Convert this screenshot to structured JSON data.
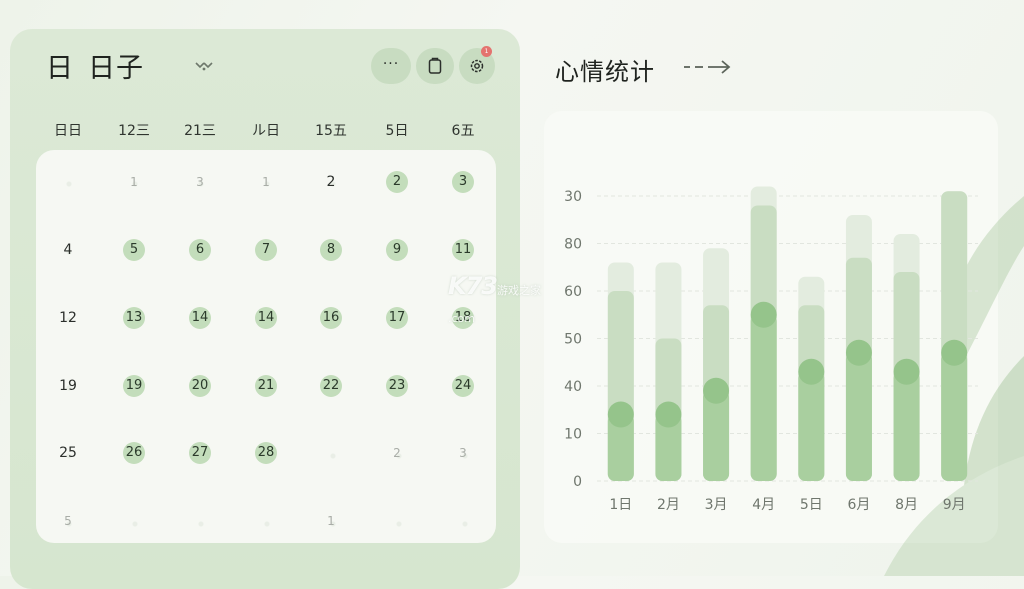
{
  "header": {
    "title_part1": "日",
    "title_part2": "日子"
  },
  "toolbar": {
    "more_label": "···",
    "notification_count": "1"
  },
  "weekdays": [
    "日日",
    "12三",
    "21三",
    "ル日",
    "15五",
    "5日",
    "6五"
  ],
  "calendar_rows": [
    [
      {
        "text": "",
        "style": "plain"
      },
      {
        "text": "1",
        "style": "faded"
      },
      {
        "text": "3",
        "style": "faded"
      },
      {
        "text": "1",
        "style": "faded"
      },
      {
        "text": "2",
        "style": "plain"
      },
      {
        "text": "2",
        "style": "dot"
      },
      {
        "text": "3",
        "style": "dot"
      }
    ],
    [
      {
        "text": "4",
        "style": "plain"
      },
      {
        "text": "5",
        "style": "dot"
      },
      {
        "text": "6",
        "style": "dot"
      },
      {
        "text": "7",
        "style": "dot"
      },
      {
        "text": "8",
        "style": "dot"
      },
      {
        "text": "9",
        "style": "dot"
      },
      {
        "text": "11",
        "style": "dot"
      }
    ],
    [
      {
        "text": "12",
        "style": "plain"
      },
      {
        "text": "13",
        "style": "dot"
      },
      {
        "text": "14",
        "style": "dot"
      },
      {
        "text": "14",
        "style": "dot"
      },
      {
        "text": "16",
        "style": "dot"
      },
      {
        "text": "17",
        "style": "dot"
      },
      {
        "text": "18",
        "style": "dot"
      }
    ],
    [
      {
        "text": "19",
        "style": "plain"
      },
      {
        "text": "19",
        "style": "dot"
      },
      {
        "text": "20",
        "style": "dot"
      },
      {
        "text": "21",
        "style": "dot"
      },
      {
        "text": "22",
        "style": "dot"
      },
      {
        "text": "23",
        "style": "dot"
      },
      {
        "text": "24",
        "style": "dot"
      }
    ],
    [
      {
        "text": "25",
        "style": "plain"
      },
      {
        "text": "26",
        "style": "dot"
      },
      {
        "text": "27",
        "style": "dot"
      },
      {
        "text": "28",
        "style": "dot"
      },
      {
        "text": "",
        "style": "plain"
      },
      {
        "text": "2",
        "style": "faded"
      },
      {
        "text": "3",
        "style": "faded"
      }
    ],
    [
      {
        "text": "5",
        "style": "faded"
      },
      {
        "text": "",
        "style": "plain"
      },
      {
        "text": "",
        "style": "plain"
      },
      {
        "text": "",
        "style": "plain"
      },
      {
        "text": "1",
        "style": "faded"
      },
      {
        "text": "",
        "style": "plain"
      },
      {
        "text": "",
        "style": "plain"
      }
    ]
  ],
  "mood": {
    "title": "心情统计"
  },
  "watermark": {
    "logo": "K73",
    "sub1": "游戏之家",
    "sub2": ".com"
  },
  "colors": {
    "accent": "#c3ddbb",
    "bar_light": "#e3ecdf",
    "bar_mid": "#c9ddc2",
    "bar_dark": "#a9cf9f",
    "marker": "#95c48b",
    "notification": "#e4736f"
  },
  "chart_data": {
    "type": "bar",
    "categories": [
      "1日",
      "2月",
      "3月",
      "4月",
      "5日",
      "6月",
      "8月",
      "9月"
    ],
    "y_tick_labels": [
      "0",
      "10",
      "40",
      "50",
      "60",
      "80",
      "30"
    ],
    "y_tick_positions": [
      0,
      1,
      2,
      3,
      4,
      5,
      6
    ],
    "ylim": [
      0,
      6.2
    ],
    "series": [
      {
        "values": [
          4.6,
          4.6,
          4.9,
          6.2,
          4.3,
          5.6,
          5.2,
          6.1
        ]
      },
      {
        "values": [
          4.0,
          3.0,
          3.7,
          5.8,
          3.7,
          4.7,
          4.4,
          6.1
        ]
      },
      {
        "values": [
          1.4,
          1.4,
          1.9,
          3.5,
          2.3,
          2.7,
          2.3,
          2.7
        ]
      }
    ],
    "markers": [
      1.4,
      1.4,
      1.9,
      3.5,
      2.3,
      2.7,
      2.3,
      2.7
    ],
    "grid": true,
    "xlabel": "",
    "ylabel": ""
  }
}
